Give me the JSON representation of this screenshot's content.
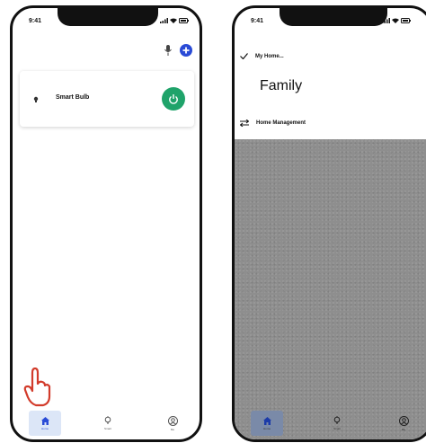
{
  "left_screen": {
    "status_time": "9:41",
    "device": {
      "name": "Smart Bulb",
      "power_on": true
    },
    "tabs": [
      {
        "label": "Home",
        "icon": "home-icon",
        "active": true
      },
      {
        "label": "Smart",
        "icon": "bulb-icon",
        "active": false
      },
      {
        "label": "Me",
        "icon": "user-icon",
        "active": false
      }
    ]
  },
  "right_screen": {
    "status_time": "9:41",
    "menu": {
      "selected_home": "My Home...",
      "heading": "Family",
      "management": "Home Management"
    },
    "tabs": [
      {
        "label": "Home",
        "icon": "home-icon",
        "active": true
      },
      {
        "label": "Smart",
        "icon": "bulb-icon",
        "active": false
      },
      {
        "label": "Me",
        "icon": "user-icon",
        "active": false
      }
    ]
  },
  "colors": {
    "power_green": "#1fa36a",
    "accent_blue": "#2a4bd6",
    "overlay_gray": "#8e8e8e",
    "hand_red": "#d23b2b"
  }
}
